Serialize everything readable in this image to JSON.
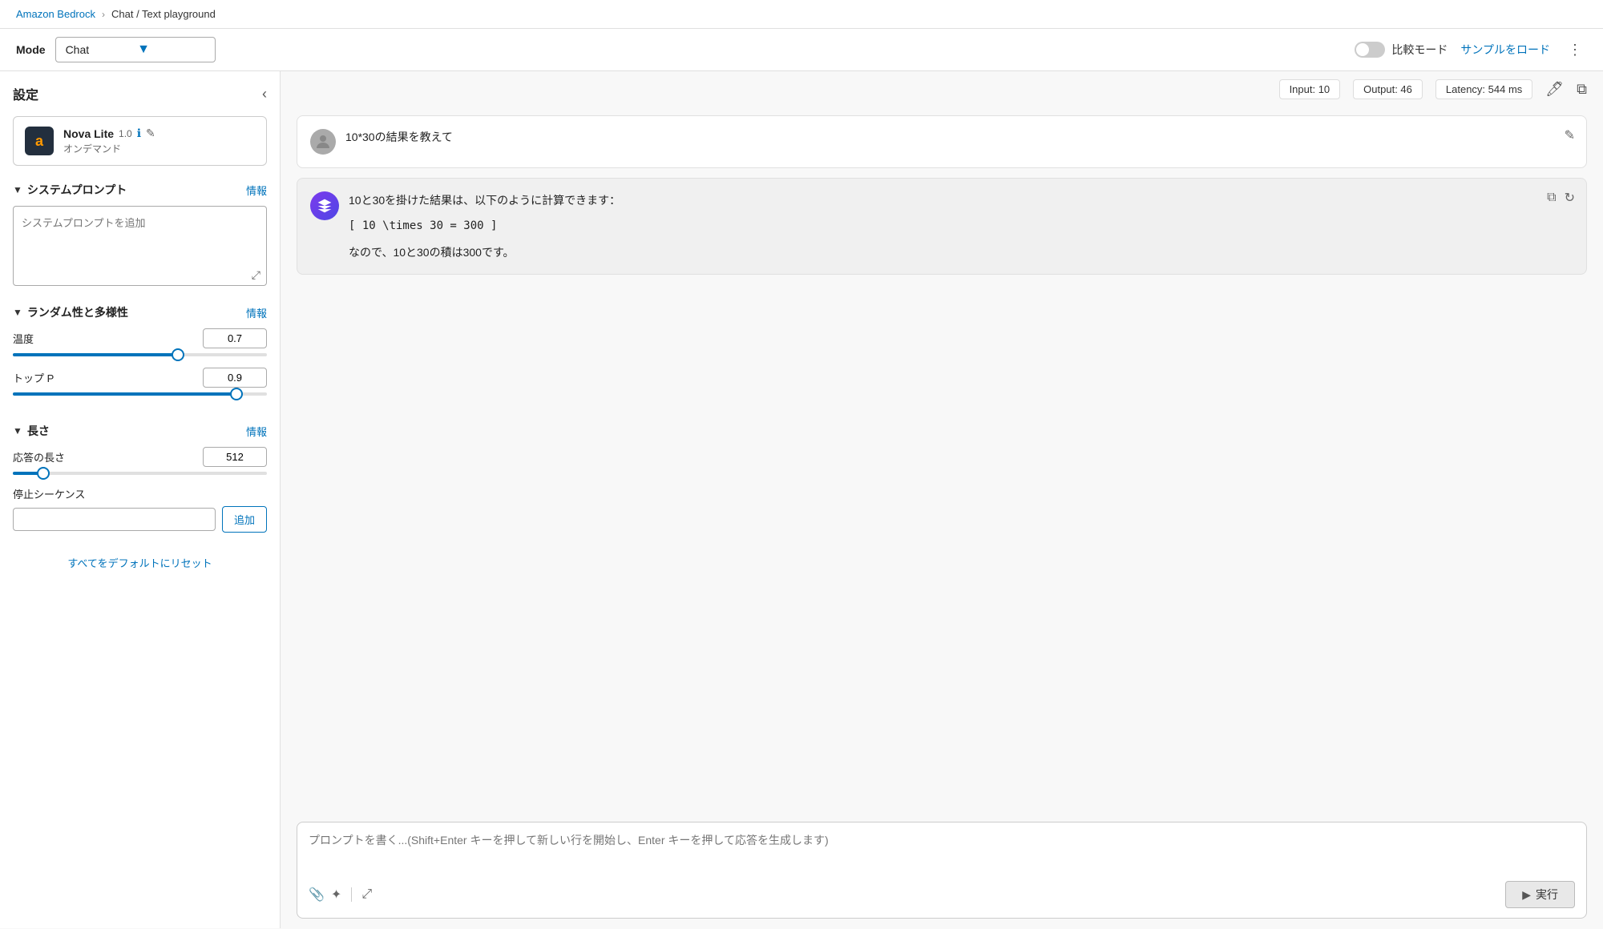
{
  "breadcrumb": {
    "link_label": "Amazon Bedrock",
    "separator": "›",
    "current": "Chat / Text playground"
  },
  "mode_bar": {
    "mode_label": "Mode",
    "mode_value": "Chat",
    "compare_mode_label": "比較モード",
    "sample_load_label": "サンプルをロード",
    "more_icon": "⋮"
  },
  "stats": {
    "input": "Input: 10",
    "output": "Output: 46",
    "latency": "Latency: 544 ms"
  },
  "sidebar": {
    "title": "設定",
    "collapse_icon": "‹",
    "model": {
      "name": "Nova Lite",
      "version": "1.0",
      "sub": "オンデマンド",
      "logo_char": "a"
    },
    "system_prompt": {
      "section_title": "システムプロンプト",
      "info_label": "情報",
      "placeholder": "システムプロンプトを追加",
      "expand_icon": "⤢"
    },
    "randomness": {
      "section_title": "ランダム性と多様性",
      "info_label": "情報",
      "temperature_label": "温度",
      "temperature_value": "0.7",
      "temperature_pct": 65,
      "top_p_label": "トップ P",
      "top_p_value": "0.9",
      "top_p_pct": 88
    },
    "length": {
      "section_title": "長さ",
      "info_label": "情報",
      "response_length_label": "応答の長さ",
      "response_length_value": "512",
      "response_length_pct": 12,
      "stop_seq_label": "停止シーケンス",
      "stop_seq_placeholder": "",
      "add_btn_label": "追加"
    },
    "reset_label": "すべてをデフォルトにリセット"
  },
  "chat": {
    "user_message": "10*30の結果を教えて",
    "ai_response_line1": "10と30を掛けた結果は、以下のように計算できます：",
    "ai_response_math": "[ 10 \\times 30 = 300 ]",
    "ai_response_line2": "なので、10と30の積は300です。",
    "input_placeholder": "プロンプトを書く...(Shift+Enter キーを押して新しい行を開始し、Enter キーを押して応答を生成します)",
    "run_label": "実行"
  },
  "icons": {
    "edit": "✎",
    "copy": "⧉",
    "refresh": "↻",
    "attachment": "📎",
    "magic": "✦",
    "expand": "⤢",
    "run_arrow": "▶"
  }
}
